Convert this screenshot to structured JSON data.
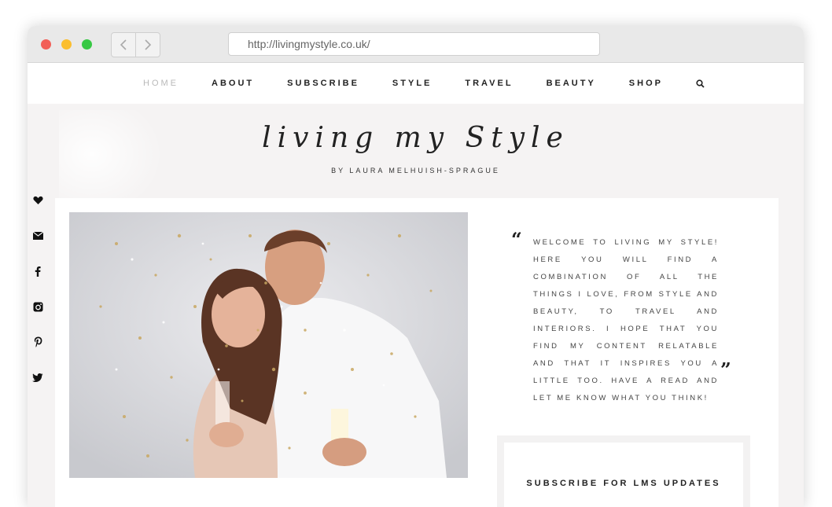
{
  "browser": {
    "url": "http://livingmystyle.co.uk/",
    "back_icon": "chevron-left-icon",
    "forward_icon": "chevron-right-icon"
  },
  "nav": {
    "items": [
      "HOME",
      "ABOUT",
      "SUBSCRIBE",
      "STYLE",
      "TRAVEL",
      "BEAUTY",
      "SHOP"
    ],
    "active": "HOME",
    "search_icon": "search-icon"
  },
  "header": {
    "logo": "living my Style",
    "byline": "BY LAURA MELHUISH-SPRAGUE"
  },
  "social": {
    "icons": [
      "heart-icon",
      "mail-icon",
      "facebook-icon",
      "instagram-icon",
      "pinterest-icon",
      "twitter-icon"
    ]
  },
  "intro": {
    "quote": "Welcome to Living My Style! Here you will find a combination of all the things I love, from style and beauty, to travel and interiors. I hope that you find my content relatable and that it inspires you a little too. Have a read and let me know what you think!"
  },
  "subscribe": {
    "title": "SUBSCRIBE FOR LMS UPDATES"
  },
  "colors": {
    "page_bg": "#f5f3f3",
    "nav_active": "#b9b9b9",
    "text": "#222222"
  }
}
